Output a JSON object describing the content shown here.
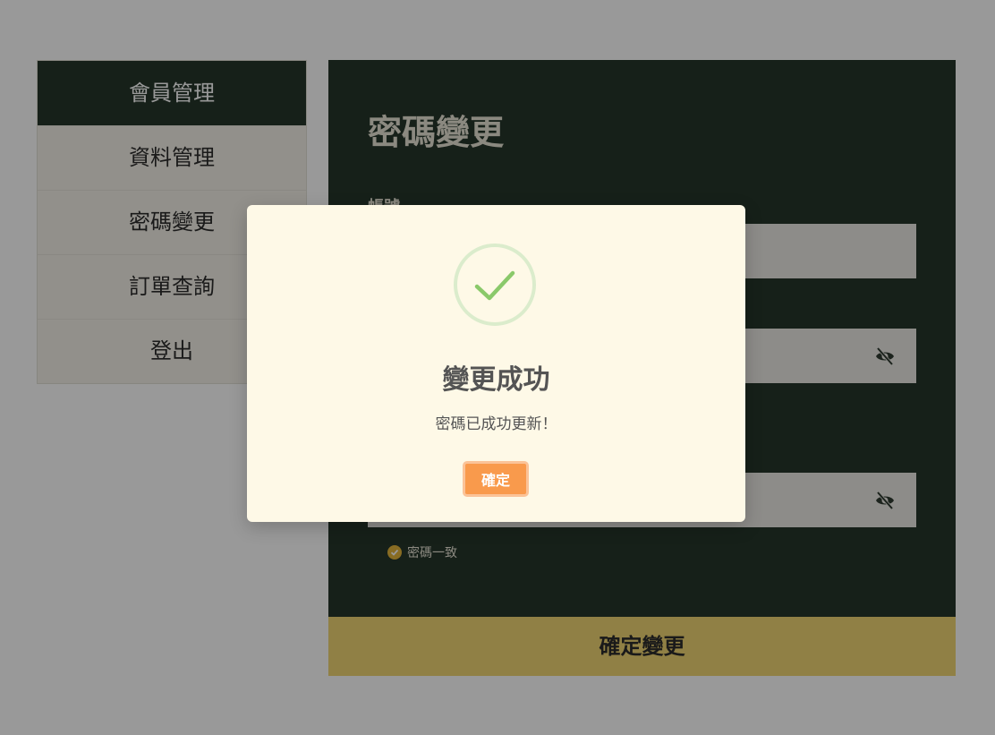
{
  "sidebar": {
    "items": [
      {
        "label": "會員管理"
      },
      {
        "label": "資料管理"
      },
      {
        "label": "密碼變更"
      },
      {
        "label": "訂單查詢"
      },
      {
        "label": "登出"
      }
    ]
  },
  "main": {
    "title": "密碼變更",
    "fields": [
      {
        "label": "帳號"
      }
    ],
    "match_text": "密碼一致",
    "submit_label": "確定變更"
  },
  "modal": {
    "title": "變更成功",
    "message": "密碼已成功更新！",
    "confirm_label": "確定"
  },
  "colors": {
    "primary": "#25362a",
    "submit": "#f1d673",
    "confirm": "#f99a4c",
    "check": "#8ac96a"
  }
}
